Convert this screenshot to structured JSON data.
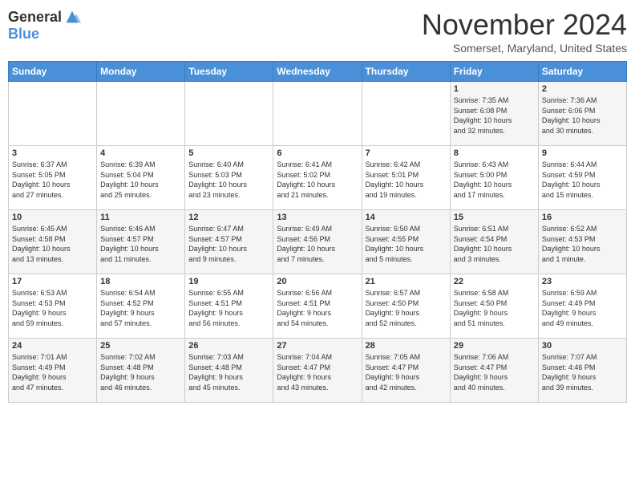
{
  "logo": {
    "general": "General",
    "blue": "Blue"
  },
  "title": "November 2024",
  "location": "Somerset, Maryland, United States",
  "days_header": [
    "Sunday",
    "Monday",
    "Tuesday",
    "Wednesday",
    "Thursday",
    "Friday",
    "Saturday"
  ],
  "weeks": [
    [
      {
        "day": "",
        "info": ""
      },
      {
        "day": "",
        "info": ""
      },
      {
        "day": "",
        "info": ""
      },
      {
        "day": "",
        "info": ""
      },
      {
        "day": "",
        "info": ""
      },
      {
        "day": "1",
        "info": "Sunrise: 7:35 AM\nSunset: 6:08 PM\nDaylight: 10 hours\nand 32 minutes."
      },
      {
        "day": "2",
        "info": "Sunrise: 7:36 AM\nSunset: 6:06 PM\nDaylight: 10 hours\nand 30 minutes."
      }
    ],
    [
      {
        "day": "3",
        "info": "Sunrise: 6:37 AM\nSunset: 5:05 PM\nDaylight: 10 hours\nand 27 minutes."
      },
      {
        "day": "4",
        "info": "Sunrise: 6:39 AM\nSunset: 5:04 PM\nDaylight: 10 hours\nand 25 minutes."
      },
      {
        "day": "5",
        "info": "Sunrise: 6:40 AM\nSunset: 5:03 PM\nDaylight: 10 hours\nand 23 minutes."
      },
      {
        "day": "6",
        "info": "Sunrise: 6:41 AM\nSunset: 5:02 PM\nDaylight: 10 hours\nand 21 minutes."
      },
      {
        "day": "7",
        "info": "Sunrise: 6:42 AM\nSunset: 5:01 PM\nDaylight: 10 hours\nand 19 minutes."
      },
      {
        "day": "8",
        "info": "Sunrise: 6:43 AM\nSunset: 5:00 PM\nDaylight: 10 hours\nand 17 minutes."
      },
      {
        "day": "9",
        "info": "Sunrise: 6:44 AM\nSunset: 4:59 PM\nDaylight: 10 hours\nand 15 minutes."
      }
    ],
    [
      {
        "day": "10",
        "info": "Sunrise: 6:45 AM\nSunset: 4:58 PM\nDaylight: 10 hours\nand 13 minutes."
      },
      {
        "day": "11",
        "info": "Sunrise: 6:46 AM\nSunset: 4:57 PM\nDaylight: 10 hours\nand 11 minutes."
      },
      {
        "day": "12",
        "info": "Sunrise: 6:47 AM\nSunset: 4:57 PM\nDaylight: 10 hours\nand 9 minutes."
      },
      {
        "day": "13",
        "info": "Sunrise: 6:49 AM\nSunset: 4:56 PM\nDaylight: 10 hours\nand 7 minutes."
      },
      {
        "day": "14",
        "info": "Sunrise: 6:50 AM\nSunset: 4:55 PM\nDaylight: 10 hours\nand 5 minutes."
      },
      {
        "day": "15",
        "info": "Sunrise: 6:51 AM\nSunset: 4:54 PM\nDaylight: 10 hours\nand 3 minutes."
      },
      {
        "day": "16",
        "info": "Sunrise: 6:52 AM\nSunset: 4:53 PM\nDaylight: 10 hours\nand 1 minute."
      }
    ],
    [
      {
        "day": "17",
        "info": "Sunrise: 6:53 AM\nSunset: 4:53 PM\nDaylight: 9 hours\nand 59 minutes."
      },
      {
        "day": "18",
        "info": "Sunrise: 6:54 AM\nSunset: 4:52 PM\nDaylight: 9 hours\nand 57 minutes."
      },
      {
        "day": "19",
        "info": "Sunrise: 6:55 AM\nSunset: 4:51 PM\nDaylight: 9 hours\nand 56 minutes."
      },
      {
        "day": "20",
        "info": "Sunrise: 6:56 AM\nSunset: 4:51 PM\nDaylight: 9 hours\nand 54 minutes."
      },
      {
        "day": "21",
        "info": "Sunrise: 6:57 AM\nSunset: 4:50 PM\nDaylight: 9 hours\nand 52 minutes."
      },
      {
        "day": "22",
        "info": "Sunrise: 6:58 AM\nSunset: 4:50 PM\nDaylight: 9 hours\nand 51 minutes."
      },
      {
        "day": "23",
        "info": "Sunrise: 6:59 AM\nSunset: 4:49 PM\nDaylight: 9 hours\nand 49 minutes."
      }
    ],
    [
      {
        "day": "24",
        "info": "Sunrise: 7:01 AM\nSunset: 4:49 PM\nDaylight: 9 hours\nand 47 minutes."
      },
      {
        "day": "25",
        "info": "Sunrise: 7:02 AM\nSunset: 4:48 PM\nDaylight: 9 hours\nand 46 minutes."
      },
      {
        "day": "26",
        "info": "Sunrise: 7:03 AM\nSunset: 4:48 PM\nDaylight: 9 hours\nand 45 minutes."
      },
      {
        "day": "27",
        "info": "Sunrise: 7:04 AM\nSunset: 4:47 PM\nDaylight: 9 hours\nand 43 minutes."
      },
      {
        "day": "28",
        "info": "Sunrise: 7:05 AM\nSunset: 4:47 PM\nDaylight: 9 hours\nand 42 minutes."
      },
      {
        "day": "29",
        "info": "Sunrise: 7:06 AM\nSunset: 4:47 PM\nDaylight: 9 hours\nand 40 minutes."
      },
      {
        "day": "30",
        "info": "Sunrise: 7:07 AM\nSunset: 4:46 PM\nDaylight: 9 hours\nand 39 minutes."
      }
    ]
  ]
}
